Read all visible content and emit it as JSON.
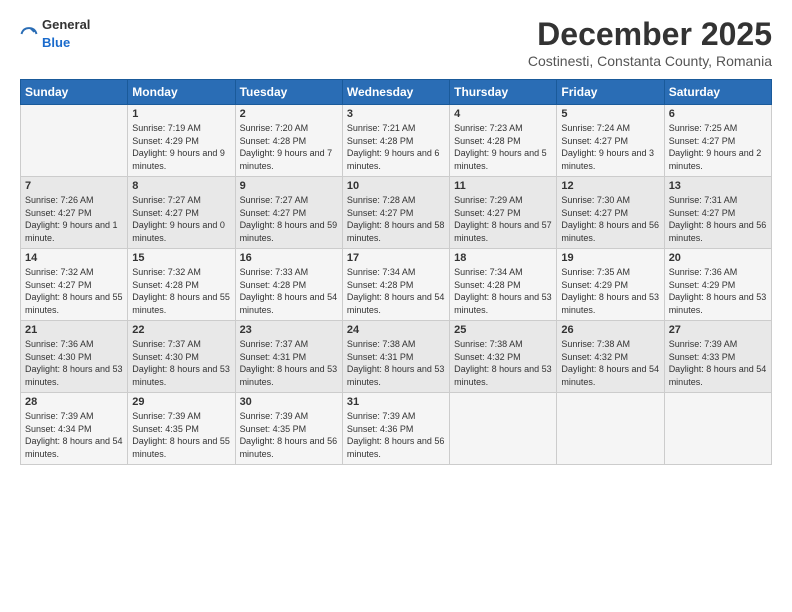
{
  "logo": {
    "general": "General",
    "blue": "Blue"
  },
  "title": "December 2025",
  "subtitle": "Costinesti, Constanta County, Romania",
  "headers": [
    "Sunday",
    "Monday",
    "Tuesday",
    "Wednesday",
    "Thursday",
    "Friday",
    "Saturday"
  ],
  "weeks": [
    [
      {
        "day": "",
        "sunrise": "",
        "sunset": "",
        "daylight": ""
      },
      {
        "day": "1",
        "sunrise": "Sunrise: 7:19 AM",
        "sunset": "Sunset: 4:29 PM",
        "daylight": "Daylight: 9 hours and 9 minutes."
      },
      {
        "day": "2",
        "sunrise": "Sunrise: 7:20 AM",
        "sunset": "Sunset: 4:28 PM",
        "daylight": "Daylight: 9 hours and 7 minutes."
      },
      {
        "day": "3",
        "sunrise": "Sunrise: 7:21 AM",
        "sunset": "Sunset: 4:28 PM",
        "daylight": "Daylight: 9 hours and 6 minutes."
      },
      {
        "day": "4",
        "sunrise": "Sunrise: 7:23 AM",
        "sunset": "Sunset: 4:28 PM",
        "daylight": "Daylight: 9 hours and 5 minutes."
      },
      {
        "day": "5",
        "sunrise": "Sunrise: 7:24 AM",
        "sunset": "Sunset: 4:27 PM",
        "daylight": "Daylight: 9 hours and 3 minutes."
      },
      {
        "day": "6",
        "sunrise": "Sunrise: 7:25 AM",
        "sunset": "Sunset: 4:27 PM",
        "daylight": "Daylight: 9 hours and 2 minutes."
      }
    ],
    [
      {
        "day": "7",
        "sunrise": "Sunrise: 7:26 AM",
        "sunset": "Sunset: 4:27 PM",
        "daylight": "Daylight: 9 hours and 1 minute."
      },
      {
        "day": "8",
        "sunrise": "Sunrise: 7:27 AM",
        "sunset": "Sunset: 4:27 PM",
        "daylight": "Daylight: 9 hours and 0 minutes."
      },
      {
        "day": "9",
        "sunrise": "Sunrise: 7:27 AM",
        "sunset": "Sunset: 4:27 PM",
        "daylight": "Daylight: 8 hours and 59 minutes."
      },
      {
        "day": "10",
        "sunrise": "Sunrise: 7:28 AM",
        "sunset": "Sunset: 4:27 PM",
        "daylight": "Daylight: 8 hours and 58 minutes."
      },
      {
        "day": "11",
        "sunrise": "Sunrise: 7:29 AM",
        "sunset": "Sunset: 4:27 PM",
        "daylight": "Daylight: 8 hours and 57 minutes."
      },
      {
        "day": "12",
        "sunrise": "Sunrise: 7:30 AM",
        "sunset": "Sunset: 4:27 PM",
        "daylight": "Daylight: 8 hours and 56 minutes."
      },
      {
        "day": "13",
        "sunrise": "Sunrise: 7:31 AM",
        "sunset": "Sunset: 4:27 PM",
        "daylight": "Daylight: 8 hours and 56 minutes."
      }
    ],
    [
      {
        "day": "14",
        "sunrise": "Sunrise: 7:32 AM",
        "sunset": "Sunset: 4:27 PM",
        "daylight": "Daylight: 8 hours and 55 minutes."
      },
      {
        "day": "15",
        "sunrise": "Sunrise: 7:32 AM",
        "sunset": "Sunset: 4:28 PM",
        "daylight": "Daylight: 8 hours and 55 minutes."
      },
      {
        "day": "16",
        "sunrise": "Sunrise: 7:33 AM",
        "sunset": "Sunset: 4:28 PM",
        "daylight": "Daylight: 8 hours and 54 minutes."
      },
      {
        "day": "17",
        "sunrise": "Sunrise: 7:34 AM",
        "sunset": "Sunset: 4:28 PM",
        "daylight": "Daylight: 8 hours and 54 minutes."
      },
      {
        "day": "18",
        "sunrise": "Sunrise: 7:34 AM",
        "sunset": "Sunset: 4:28 PM",
        "daylight": "Daylight: 8 hours and 53 minutes."
      },
      {
        "day": "19",
        "sunrise": "Sunrise: 7:35 AM",
        "sunset": "Sunset: 4:29 PM",
        "daylight": "Daylight: 8 hours and 53 minutes."
      },
      {
        "day": "20",
        "sunrise": "Sunrise: 7:36 AM",
        "sunset": "Sunset: 4:29 PM",
        "daylight": "Daylight: 8 hours and 53 minutes."
      }
    ],
    [
      {
        "day": "21",
        "sunrise": "Sunrise: 7:36 AM",
        "sunset": "Sunset: 4:30 PM",
        "daylight": "Daylight: 8 hours and 53 minutes."
      },
      {
        "day": "22",
        "sunrise": "Sunrise: 7:37 AM",
        "sunset": "Sunset: 4:30 PM",
        "daylight": "Daylight: 8 hours and 53 minutes."
      },
      {
        "day": "23",
        "sunrise": "Sunrise: 7:37 AM",
        "sunset": "Sunset: 4:31 PM",
        "daylight": "Daylight: 8 hours and 53 minutes."
      },
      {
        "day": "24",
        "sunrise": "Sunrise: 7:38 AM",
        "sunset": "Sunset: 4:31 PM",
        "daylight": "Daylight: 8 hours and 53 minutes."
      },
      {
        "day": "25",
        "sunrise": "Sunrise: 7:38 AM",
        "sunset": "Sunset: 4:32 PM",
        "daylight": "Daylight: 8 hours and 53 minutes."
      },
      {
        "day": "26",
        "sunrise": "Sunrise: 7:38 AM",
        "sunset": "Sunset: 4:32 PM",
        "daylight": "Daylight: 8 hours and 54 minutes."
      },
      {
        "day": "27",
        "sunrise": "Sunrise: 7:39 AM",
        "sunset": "Sunset: 4:33 PM",
        "daylight": "Daylight: 8 hours and 54 minutes."
      }
    ],
    [
      {
        "day": "28",
        "sunrise": "Sunrise: 7:39 AM",
        "sunset": "Sunset: 4:34 PM",
        "daylight": "Daylight: 8 hours and 54 minutes."
      },
      {
        "day": "29",
        "sunrise": "Sunrise: 7:39 AM",
        "sunset": "Sunset: 4:35 PM",
        "daylight": "Daylight: 8 hours and 55 minutes."
      },
      {
        "day": "30",
        "sunrise": "Sunrise: 7:39 AM",
        "sunset": "Sunset: 4:35 PM",
        "daylight": "Daylight: 8 hours and 56 minutes."
      },
      {
        "day": "31",
        "sunrise": "Sunrise: 7:39 AM",
        "sunset": "Sunset: 4:36 PM",
        "daylight": "Daylight: 8 hours and 56 minutes."
      },
      {
        "day": "",
        "sunrise": "",
        "sunset": "",
        "daylight": ""
      },
      {
        "day": "",
        "sunrise": "",
        "sunset": "",
        "daylight": ""
      },
      {
        "day": "",
        "sunrise": "",
        "sunset": "",
        "daylight": ""
      }
    ]
  ]
}
